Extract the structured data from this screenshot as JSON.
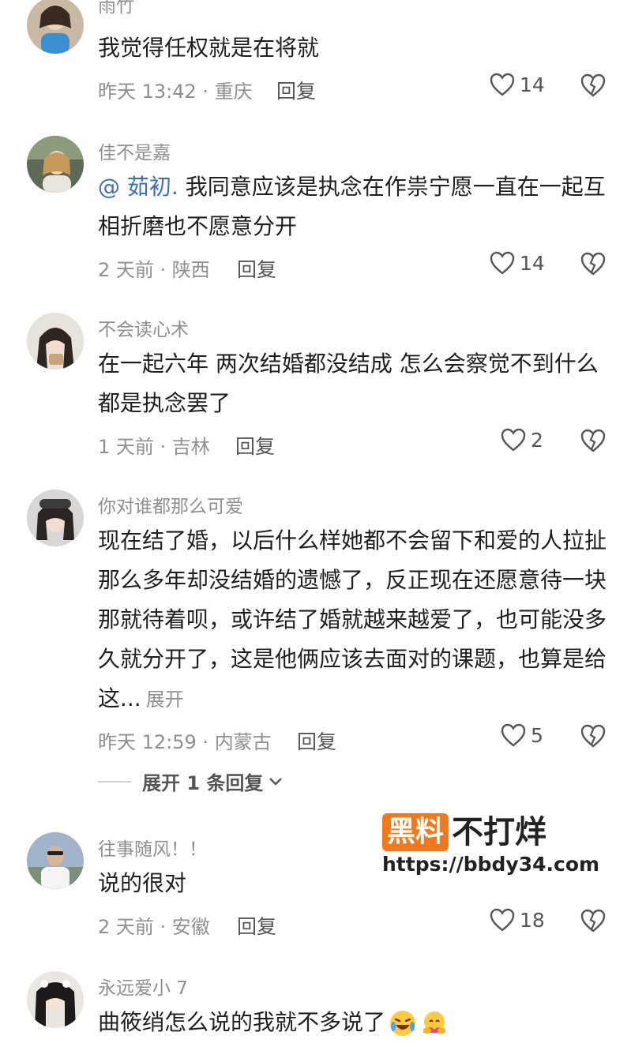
{
  "comments": [
    {
      "username": "雨竹",
      "text": "我觉得任权就是在将就",
      "time": "昨天 13:42",
      "location": "重庆",
      "reply_label": "回复",
      "likes": "14"
    },
    {
      "username": "佳不是嘉",
      "mention": "@ 茹初.",
      "text": " 我同意应该是执念在作祟宁愿一直在一起互相折磨也不愿意分开",
      "time": "2 天前",
      "location": "陕西",
      "reply_label": "回复",
      "likes": "14"
    },
    {
      "username": "不会读心术",
      "text": "在一起六年 两次结婚都没结成 怎么会察觉不到什么 都是执念罢了",
      "time": "1 天前",
      "location": "吉林",
      "reply_label": "回复",
      "likes": "2"
    },
    {
      "username": "你对谁都那么可爱",
      "text": "现在结了婚，以后什么样她都不会留下和爱的人拉扯那么多年却没结婚的遗憾了，反正现在还愿意待一块那就待着呗，或许结了婚就越来越爱了，也可能没多久就分开了，这是他俩应该去面对的课题，也算是给这...",
      "expand_label": "展开",
      "time": "昨天 12:59",
      "location": "内蒙古",
      "reply_label": "回复",
      "likes": "5",
      "more_replies": "展开 1 条回复"
    },
    {
      "username": "往事随风！！",
      "text": "说的很对",
      "time": "2 天前",
      "location": "安徽",
      "reply_label": "回复",
      "likes": "18"
    },
    {
      "username": "永远爱小 7",
      "text": "曲筱绡怎么说的我就不多说了",
      "emojis": [
        "laughing-crying",
        "hug"
      ]
    }
  ],
  "watermark": {
    "badge": "黑料",
    "title": "不打烊",
    "url": "https://bbdy34.com"
  },
  "colors": {
    "meta": "#8f8f8f",
    "mention": "#3d6fb6",
    "brand": "#f07a1b"
  }
}
